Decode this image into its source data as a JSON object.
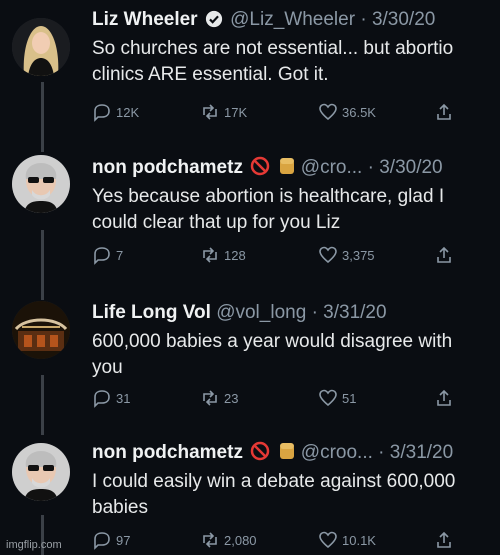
{
  "tweets": [
    {
      "name": "Liz Wheeler",
      "handle": "@Liz_Wheeler",
      "sep": "·",
      "date": "3/30/20",
      "text": "So churches are not essential... but abortio\nclinics ARE essential. Got it.",
      "replies": "12K",
      "retweets": "17K",
      "likes": "36.5K",
      "verified": true,
      "avatar_icon": "blonde-woman-avatar"
    },
    {
      "name": "non podchametz",
      "handle": "@cro...",
      "sep": "·",
      "date": "3/30/20",
      "text": "Yes because abortion is healthcare, glad I\ncould clear that up for you Liz",
      "replies": "7",
      "retweets": "128",
      "likes": "3,375",
      "avatar_icon": "bald-man-sunglasses-avatar"
    },
    {
      "name": "Life Long Vol",
      "handle": "@vol_long",
      "sep": "·",
      "date": "3/31/20",
      "text": "600,000 babies a year would disagree with\nyou",
      "replies": "31",
      "retweets": "23",
      "likes": "51",
      "avatar_icon": "vol-logo-avatar"
    },
    {
      "name": "non podchametz",
      "handle": "@croo...",
      "sep": "·",
      "date": "3/31/20",
      "text": "I could easily win a debate against 600,000\nbabies",
      "replies": "97",
      "retweets": "2,080",
      "likes": "10.1K",
      "avatar_icon": "bald-man-sunglasses-avatar"
    }
  ],
  "watermark": "imgflip.com",
  "colors": {
    "background": "#0a0d12",
    "muted": "#8b98a5",
    "text": "#e7e9ea",
    "verified": "#1d9bf0"
  }
}
